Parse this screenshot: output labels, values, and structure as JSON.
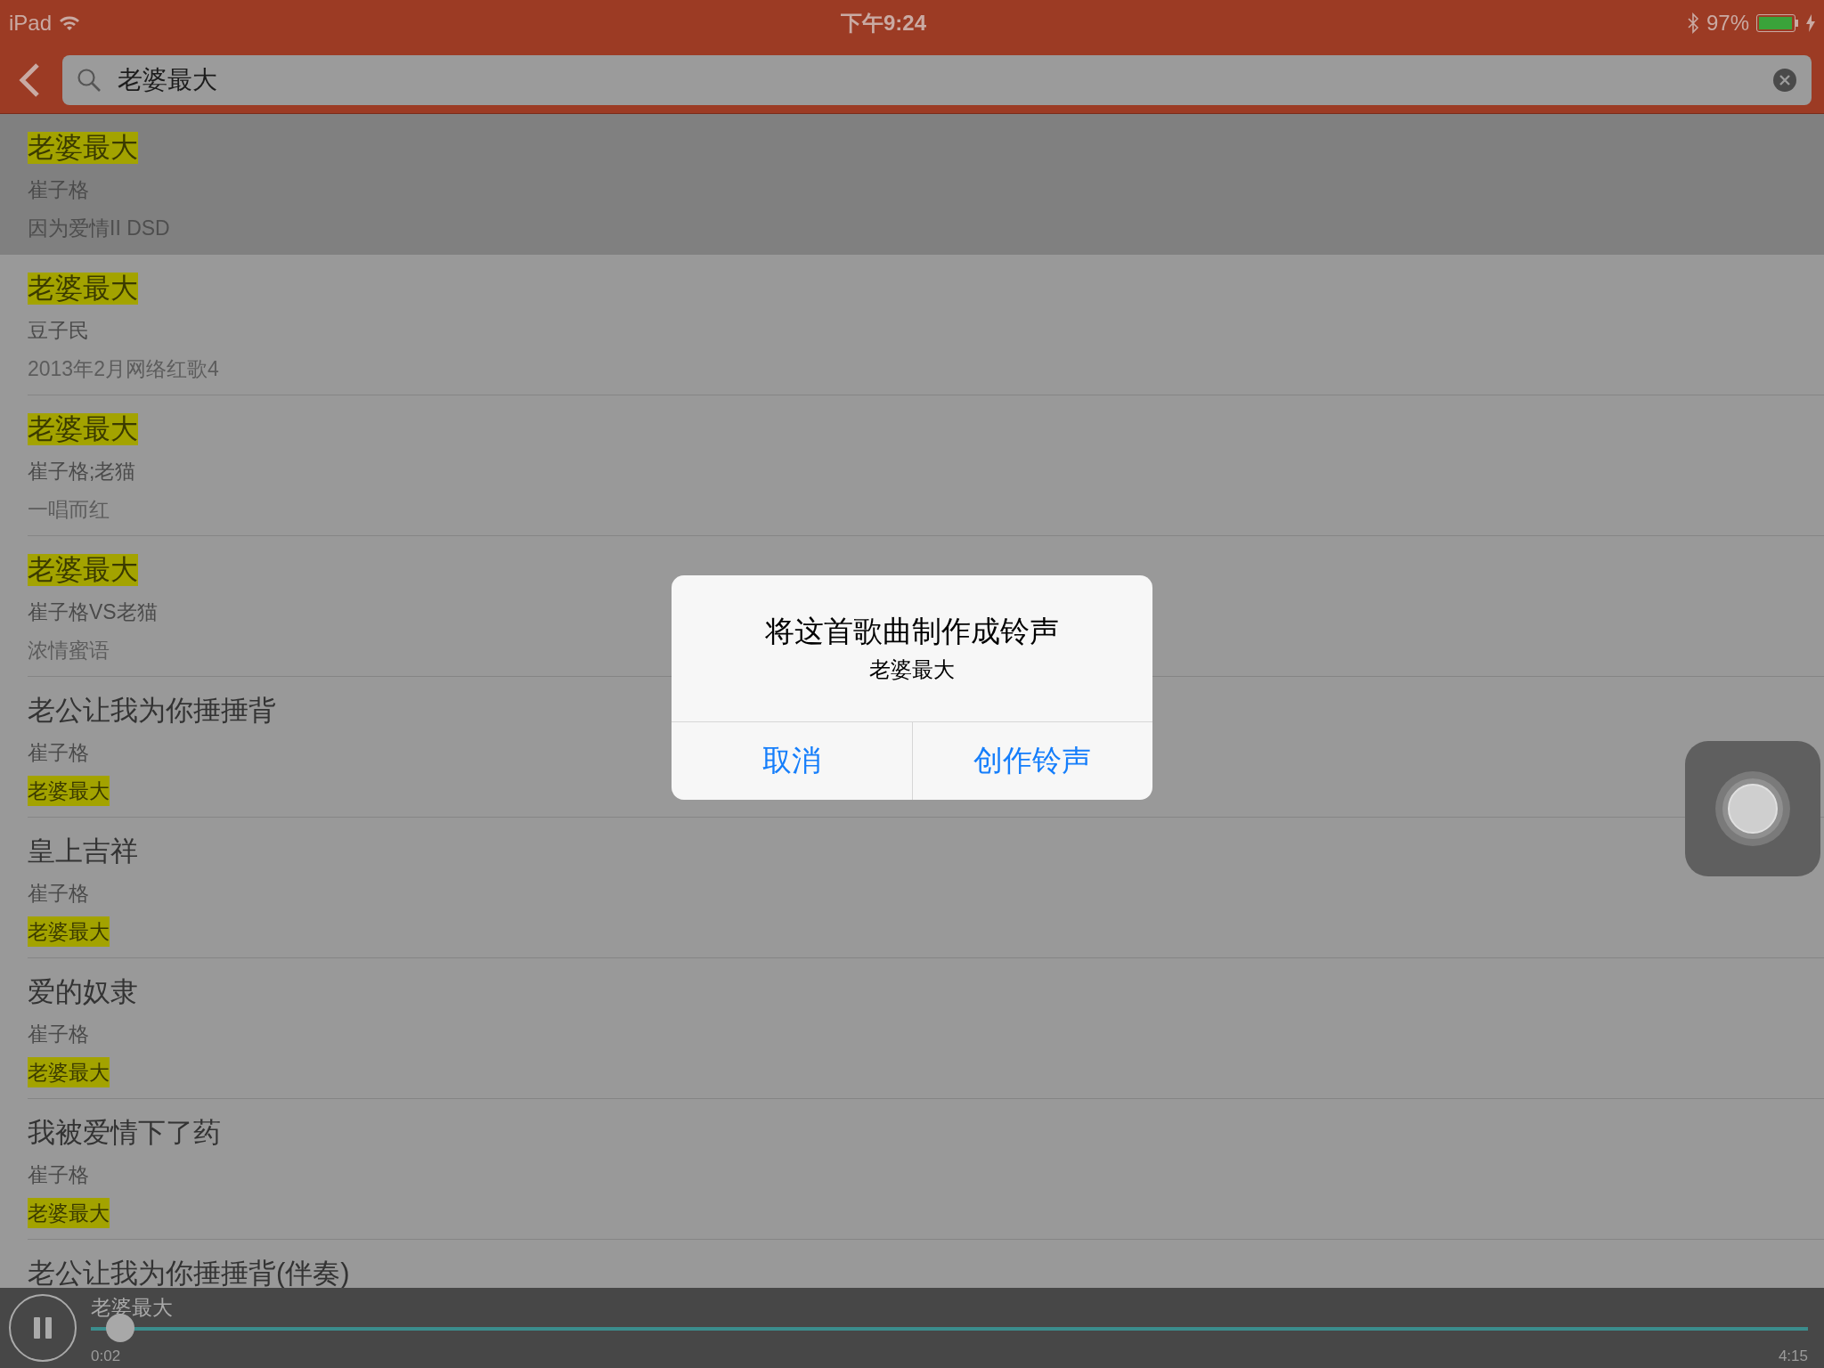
{
  "status_bar": {
    "device": "iPad",
    "time": "下午9:24",
    "battery_text": "97%",
    "battery": {
      "level": 0.97
    }
  },
  "search": {
    "value": "老婆最大"
  },
  "songs": [
    {
      "title": "老婆最大",
      "artist": "崔子格",
      "album": "因为爱情II DSD",
      "title_highlighted": true,
      "album_highlighted": false,
      "selected": true
    },
    {
      "title": "老婆最大",
      "artist": "豆子民",
      "album": "2013年2月网络红歌4",
      "title_highlighted": true,
      "album_highlighted": false,
      "selected": false
    },
    {
      "title": "老婆最大",
      "artist": "崔子格;老猫",
      "album": "一唱而红",
      "title_highlighted": true,
      "album_highlighted": false,
      "selected": false
    },
    {
      "title": "老婆最大",
      "artist": "崔子格VS老猫",
      "album": "浓情蜜语",
      "title_highlighted": true,
      "album_highlighted": false,
      "selected": false
    },
    {
      "title": "老公让我为你捶捶背",
      "artist": "崔子格",
      "album": "老婆最大",
      "title_highlighted": false,
      "album_highlighted": true,
      "selected": false
    },
    {
      "title": "皇上吉祥",
      "artist": "崔子格",
      "album": "老婆最大",
      "title_highlighted": false,
      "album_highlighted": true,
      "selected": false
    },
    {
      "title": "爱的奴隶",
      "artist": "崔子格",
      "album": "老婆最大",
      "title_highlighted": false,
      "album_highlighted": true,
      "selected": false
    },
    {
      "title": "我被爱情下了药",
      "artist": "崔子格",
      "album": "老婆最大",
      "title_highlighted": false,
      "album_highlighted": true,
      "selected": false
    },
    {
      "title": "老公让我为你捶捶背(伴奏)",
      "title_highlighted": false,
      "selected": false
    }
  ],
  "player": {
    "playing": true,
    "title": "老婆最大",
    "progress": {
      "level": 0.017
    },
    "elapsed": "0:02",
    "duration": "4:15"
  },
  "dialog": {
    "title": "将这首歌曲制作成铃声",
    "message": "老婆最大",
    "buttons": [
      "取消",
      "创作铃声"
    ]
  }
}
